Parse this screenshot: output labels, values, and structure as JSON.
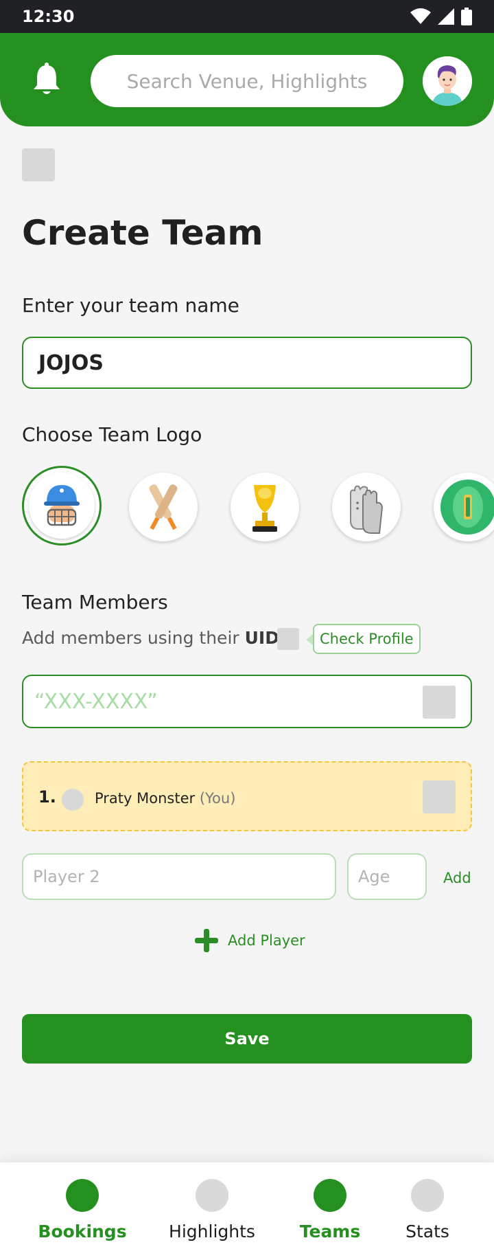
{
  "status_bar": {
    "time": "12:30"
  },
  "header": {
    "search_placeholder": "Search Venue, Highlights"
  },
  "page": {
    "title": "Create Team"
  },
  "team_name": {
    "label": "Enter your team name",
    "value": "JOJOS"
  },
  "team_logo": {
    "label": "Choose Team Logo",
    "options": [
      "cricket-helmet-player",
      "crossed-bats",
      "world-cup-trophy",
      "batting-gloves",
      "cricket-pitch"
    ],
    "selected": "cricket-helmet-player"
  },
  "members": {
    "label": "Team Members",
    "subtext_prefix": "Add members using their",
    "subtext_bold": "UID",
    "check_profile": "Check Profile",
    "uid_placeholder": "“XXX-XXXX”",
    "list": [
      {
        "num": "1.",
        "name": "Praty Monster",
        "suffix": "(You)"
      }
    ],
    "player_placeholder": "Player 2",
    "age_placeholder": "Age",
    "add_label": "Add",
    "add_player_label": "Add Player"
  },
  "save_label": "Save",
  "nav": {
    "items": [
      {
        "label": "Bookings",
        "active": true
      },
      {
        "label": "Highlights",
        "active": false
      },
      {
        "label": "Teams",
        "active": true
      },
      {
        "label": "Stats",
        "active": false
      }
    ]
  },
  "colors": {
    "primary": "#23901f",
    "card": "#feedb6",
    "card_border": "#f0c640",
    "placeholder_green": "#a7dca4"
  }
}
